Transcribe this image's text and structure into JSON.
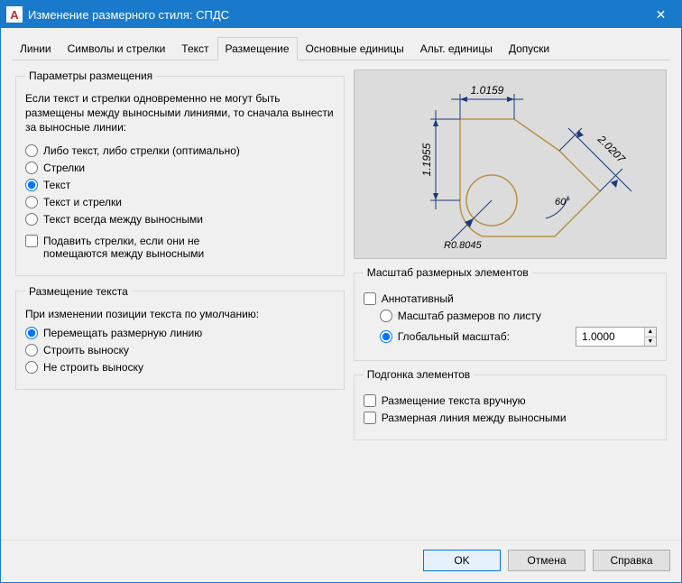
{
  "window": {
    "title": "Изменение размерного стиля: СПДС",
    "app_icon_letter": "A",
    "close_glyph": "✕"
  },
  "tabs": {
    "items": [
      {
        "label": "Линии"
      },
      {
        "label": "Символы и стрелки"
      },
      {
        "label": "Текст"
      },
      {
        "label": "Размещение"
      },
      {
        "label": "Основные единицы"
      },
      {
        "label": "Альт. единицы"
      },
      {
        "label": "Допуски"
      }
    ],
    "active_index": 3
  },
  "fit_options": {
    "legend": "Параметры размещения",
    "description": "Если текст и стрелки одновременно не могут быть размещены между выносными линиями, то сначала вынести за выносные линии:",
    "options": [
      "Либо текст, либо стрелки (оптимально)",
      "Стрелки",
      "Текст",
      "Текст и стрелки",
      "Текст всегда между выносными"
    ],
    "selected_index": 2,
    "suppress_arrows": {
      "checked": false,
      "label_line1": "Подавить стрелки, если они не",
      "label_line2": "помещаются между выносными"
    }
  },
  "text_placement": {
    "legend": "Размещение текста",
    "description": "При изменении позиции текста по умолчанию:",
    "options": [
      "Перемещать размерную линию",
      "Строить выноску",
      "Не строить выноску"
    ],
    "selected_index": 0
  },
  "preview": {
    "dims": {
      "top": "1.0159",
      "left": "1.1955",
      "diag": "2.0207",
      "angle": "60°",
      "radius": "R0.8045"
    }
  },
  "scale": {
    "legend": "Масштаб размерных элементов",
    "annotative": {
      "checked": false,
      "label": "Аннотативный"
    },
    "options": [
      "Масштаб размеров по листу",
      "Глобальный масштаб:"
    ],
    "selected_index": 1,
    "global_value": "1.0000"
  },
  "fine_tuning": {
    "legend": "Подгонка элементов",
    "manual": {
      "checked": false,
      "label": "Размещение текста вручную"
    },
    "dimline_between": {
      "checked": false,
      "label": "Размерная линия между выносными"
    }
  },
  "buttons": {
    "ok": "OK",
    "cancel": "Отмена",
    "help": "Справка"
  }
}
